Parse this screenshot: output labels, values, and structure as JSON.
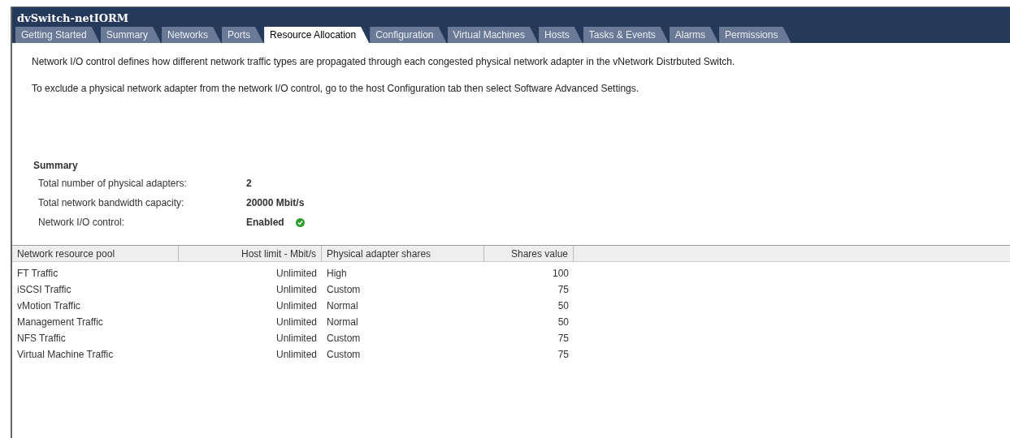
{
  "window": {
    "title": "dvSwitch-netIORM"
  },
  "tabs": [
    {
      "label": "Getting Started",
      "selected": false
    },
    {
      "label": "Summary",
      "selected": false
    },
    {
      "label": "Networks",
      "selected": false
    },
    {
      "label": "Ports",
      "selected": false
    },
    {
      "label": "Resource Allocation",
      "selected": true
    },
    {
      "label": "Configuration",
      "selected": false
    },
    {
      "label": "Virtual Machines",
      "selected": false
    },
    {
      "label": "Hosts",
      "selected": false
    },
    {
      "label": "Tasks & Events",
      "selected": false
    },
    {
      "label": "Alarms",
      "selected": false
    },
    {
      "label": "Permissions",
      "selected": false
    }
  ],
  "description": [
    "Network I/O control defines how different network traffic types are propagated through each congested physical network adapter in the vNetwork Distrbuted Switch.",
    "To exclude a physical network adapter from the network I/O control, go to the host Configuration tab then select Software Advanced Settings."
  ],
  "summary": {
    "title": "Summary",
    "items": [
      {
        "label": "Total number of physical adapters:",
        "value": "2"
      },
      {
        "label": "Total network bandwidth capacity:",
        "value": "20000 Mbit/s"
      },
      {
        "label": "Network I/O control:",
        "value": "Enabled",
        "on": true
      }
    ]
  },
  "table": {
    "columns": [
      "Network resource pool",
      "Host limit - Mbit/s",
      "Physical adapter shares",
      "Shares value"
    ],
    "rows": [
      [
        "FT Traffic",
        "Unlimited",
        "High",
        "100"
      ],
      [
        "iSCSI Traffic",
        "Unlimited",
        "Custom",
        "75"
      ],
      [
        "vMotion Traffic",
        "Unlimited",
        "Normal",
        "50"
      ],
      [
        "Management Traffic",
        "Unlimited",
        "Normal",
        "50"
      ],
      [
        "NFS Traffic",
        "Unlimited",
        "Custom",
        "75"
      ],
      [
        "Virtual Machine Traffic",
        "Unlimited",
        "Custom",
        "75"
      ]
    ]
  }
}
